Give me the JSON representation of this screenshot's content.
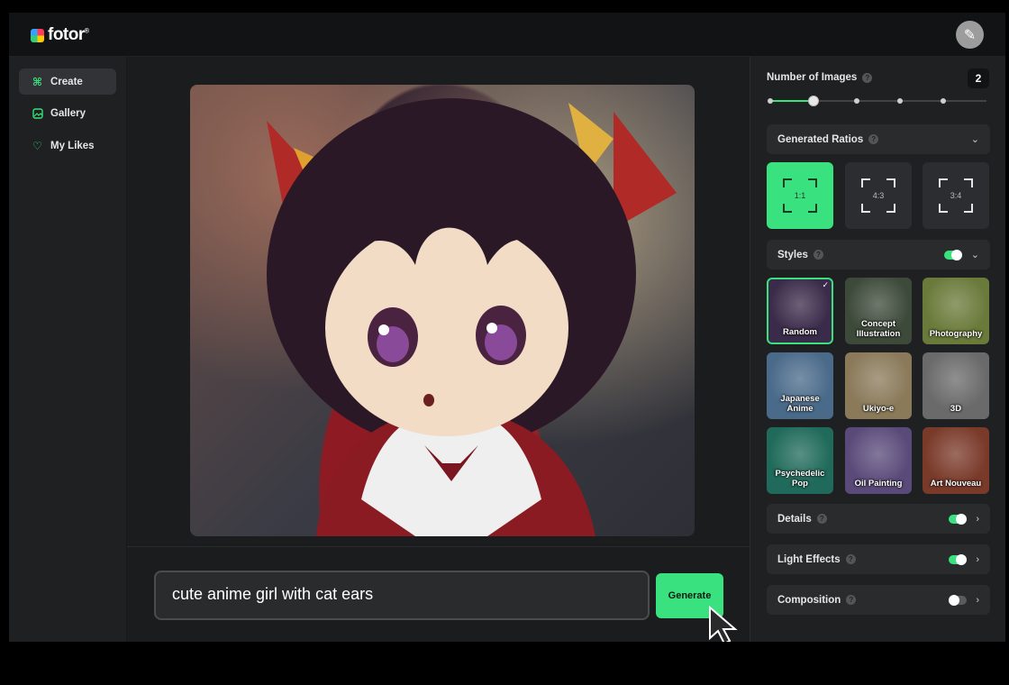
{
  "app": {
    "logo_text": "fotor",
    "logo_mark": "®"
  },
  "sidebar": {
    "items": [
      {
        "label": "Create",
        "icon": "command-icon",
        "active": true
      },
      {
        "label": "Gallery",
        "icon": "image-icon",
        "active": false
      },
      {
        "label": "My Likes",
        "icon": "heart-icon",
        "active": false
      }
    ]
  },
  "prompt": {
    "value": "cute anime girl with cat ears",
    "generate_label": "Generate"
  },
  "panel": {
    "num_images_label": "Number of Images",
    "num_images_value": "2",
    "slider_value": 2,
    "slider_max": 5,
    "ratios_label": "Generated Ratios",
    "ratios": [
      {
        "label": "1:1",
        "selected": true
      },
      {
        "label": "4:3",
        "selected": false
      },
      {
        "label": "3:4",
        "selected": false
      }
    ],
    "styles_label": "Styles",
    "styles_enabled": true,
    "styles": [
      {
        "label": "Random",
        "selected": true,
        "bg": "#3b2b4a"
      },
      {
        "label": "Concept Illustration",
        "selected": false,
        "bg": "#3d4a3a"
      },
      {
        "label": "Photography",
        "selected": false,
        "bg": "#6a7a3a"
      },
      {
        "label": "Japanese Anime",
        "selected": false,
        "bg": "#4a6a8a"
      },
      {
        "label": "Ukiyo-e",
        "selected": false,
        "bg": "#8a7a5a"
      },
      {
        "label": "3D",
        "selected": false,
        "bg": "#6a6a6a"
      },
      {
        "label": "Psychedelic Pop",
        "selected": false,
        "bg": "#1f6a5a"
      },
      {
        "label": "Oil Painting",
        "selected": false,
        "bg": "#5a4a7a"
      },
      {
        "label": "Art Nouveau",
        "selected": false,
        "bg": "#7a3a2a"
      }
    ],
    "details_label": "Details",
    "details_enabled": true,
    "light_label": "Light Effects",
    "light_enabled": true,
    "composition_label": "Composition",
    "composition_enabled": false
  },
  "colors": {
    "accent": "#3ae27f",
    "bg": "#1b1c1e",
    "panel": "#1f2022"
  }
}
